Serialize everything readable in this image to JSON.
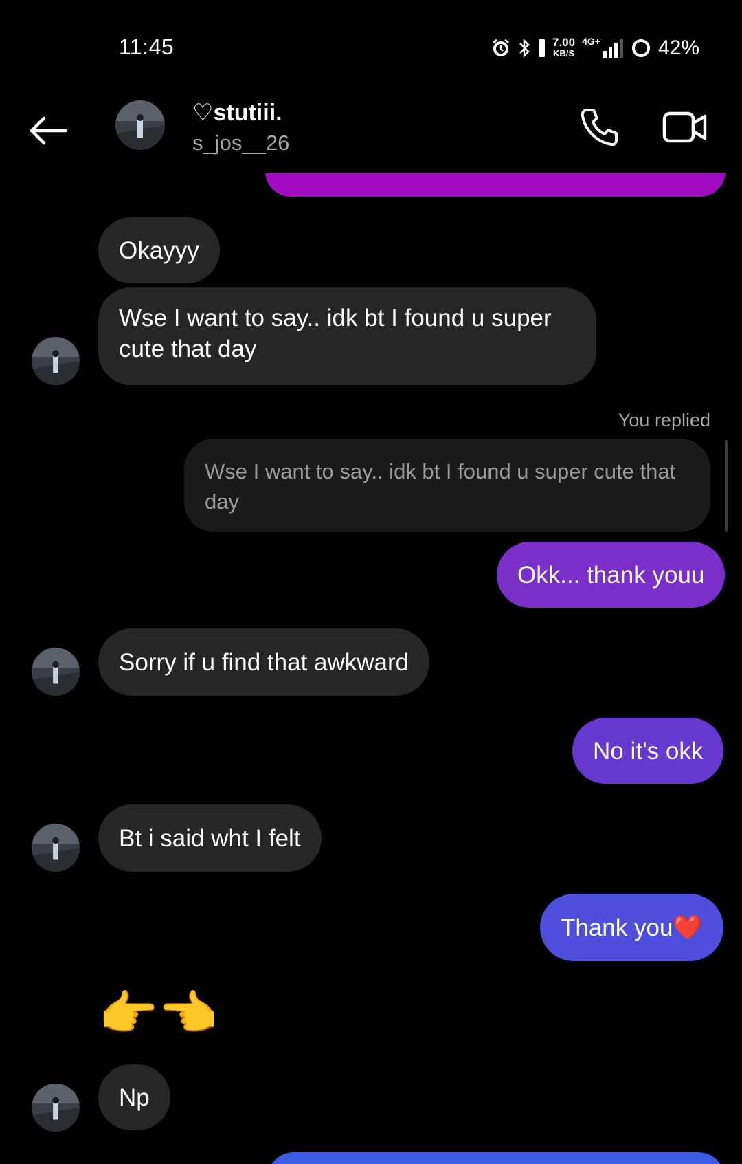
{
  "status_bar": {
    "time": "11:45",
    "net_speed_value": "7.00",
    "net_speed_unit": "KB/S",
    "network_type": "4G+",
    "battery": "42%"
  },
  "header": {
    "display_name": "♡stutiii.",
    "username": "s_jos__26"
  },
  "messages": {
    "m1": "Okayyy",
    "m2": "Wse I want to say..  idk bt I found u super cute that day",
    "replied_label": "You replied",
    "reply_quote": "Wse I want to say..  idk bt I found u super cute that day",
    "m3": "Okk... thank youu",
    "m4": "Sorry if u find that awkward",
    "m5": "No it's okk",
    "m6": "Bt i said wht I felt",
    "m7": "Thank you❤️",
    "m8": "👉👈",
    "m9": "Np"
  },
  "colors": {
    "incoming_bubble": "#262626",
    "outgoing_gradient_top": "#a10bc2",
    "outgoing_mid": "#7a33d4",
    "outgoing_bottom": "#3d5ce6"
  }
}
